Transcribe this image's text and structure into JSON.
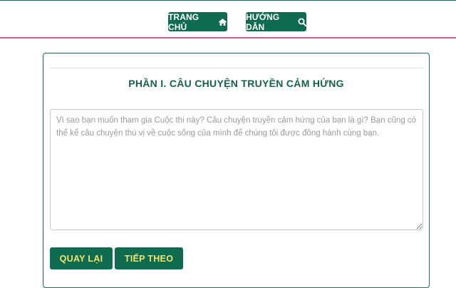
{
  "nav": {
    "home_label": "TRANG CHỦ",
    "guide_label": "HƯỚNG DẪN"
  },
  "icons": {
    "home": "home-icon",
    "search": "search-icon"
  },
  "colors": {
    "primary_green": "#0f6b4f",
    "accent_yellow": "#f5e26a",
    "divider_pink": "#d9588a"
  },
  "section": {
    "title": "PHẦN I. CÂU CHUYỆN TRUYỀN CẢM HỨNG"
  },
  "story": {
    "value": "",
    "placeholder": "Vì sao bạn muốn tham gia Cuộc thi này? Câu chuyện truyền cảm hứng của bạn là gì? Bạn cũng có thể kể câu chuyện thú vị về cuộc sống của mình để chúng tôi được đồng hành cùng bạn."
  },
  "actions": {
    "back_label": "QUAY LẠI",
    "next_label": "TIẾP THEO"
  }
}
